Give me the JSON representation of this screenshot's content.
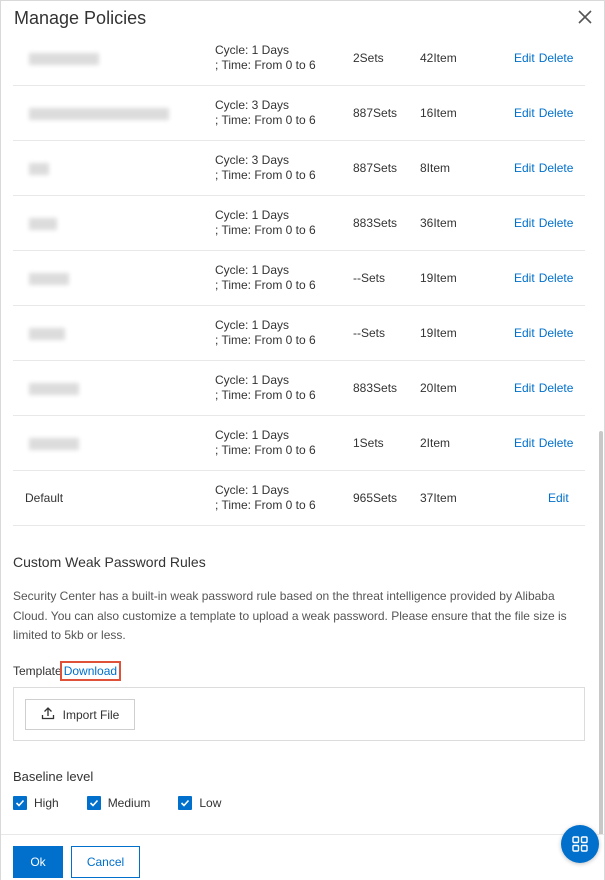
{
  "dialog": {
    "title": "Manage Policies"
  },
  "policies": [
    {
      "cycle_line1": "Cycle: 1 Days",
      "cycle_line2": "; Time: From 0 to 6",
      "sets": "2Sets",
      "items": "42Item",
      "edit": "Edit",
      "delete": "Delete"
    },
    {
      "cycle_line1": "Cycle: 3 Days",
      "cycle_line2": "; Time: From 0 to 6",
      "sets": "887Sets",
      "items": "16Item",
      "edit": "Edit",
      "delete": "Delete"
    },
    {
      "cycle_line1": "Cycle: 3 Days",
      "cycle_line2": "; Time: From 0 to 6",
      "sets": "887Sets",
      "items": "8Item",
      "edit": "Edit",
      "delete": "Delete"
    },
    {
      "cycle_line1": "Cycle: 1 Days",
      "cycle_line2": "; Time: From 0 to 6",
      "sets": "883Sets",
      "items": "36Item",
      "edit": "Edit",
      "delete": "Delete"
    },
    {
      "cycle_line1": "Cycle: 1 Days",
      "cycle_line2": "; Time: From 0 to 6",
      "sets": "--Sets",
      "items": "19Item",
      "edit": "Edit",
      "delete": "Delete"
    },
    {
      "cycle_line1": "Cycle: 1 Days",
      "cycle_line2": "; Time: From 0 to 6",
      "sets": "--Sets",
      "items": "19Item",
      "edit": "Edit",
      "delete": "Delete"
    },
    {
      "cycle_line1": "Cycle: 1 Days",
      "cycle_line2": "; Time: From 0 to 6",
      "sets": "883Sets",
      "items": "20Item",
      "edit": "Edit",
      "delete": "Delete"
    },
    {
      "cycle_line1": "Cycle: 1 Days",
      "cycle_line2": "; Time: From 0 to 6",
      "sets": "1Sets",
      "items": "2Item",
      "edit": "Edit",
      "delete": "Delete"
    },
    {
      "name": "Default",
      "cycle_line1": "Cycle: 1 Days",
      "cycle_line2": "; Time: From 0 to 6",
      "sets": "965Sets",
      "items": "37Item",
      "edit": "Edit"
    }
  ],
  "weak_password": {
    "title": "Custom Weak Password Rules",
    "description": "Security Center has a built-in weak password rule based on the threat intelligence provided by Alibaba Cloud. You can also customize a template to upload a weak password. Please ensure that the file size is limited to 5kb or less.",
    "template_label": "Template",
    "download_label": "Download",
    "import_label": "Import File",
    "import_icon": "upload-icon"
  },
  "baseline": {
    "title": "Baseline level",
    "options": [
      {
        "label": "High",
        "checked": true
      },
      {
        "label": "Medium",
        "checked": true
      },
      {
        "label": "Low",
        "checked": true
      }
    ]
  },
  "footer": {
    "ok_label": "Ok",
    "cancel_label": "Cancel"
  },
  "icons": {
    "close": "close-icon",
    "fab": "grid-apps-icon",
    "checkbox": "check-icon"
  },
  "colors": {
    "primary": "#0070cc",
    "highlight_border": "#e0513a",
    "checkbox": "#0070cc"
  }
}
